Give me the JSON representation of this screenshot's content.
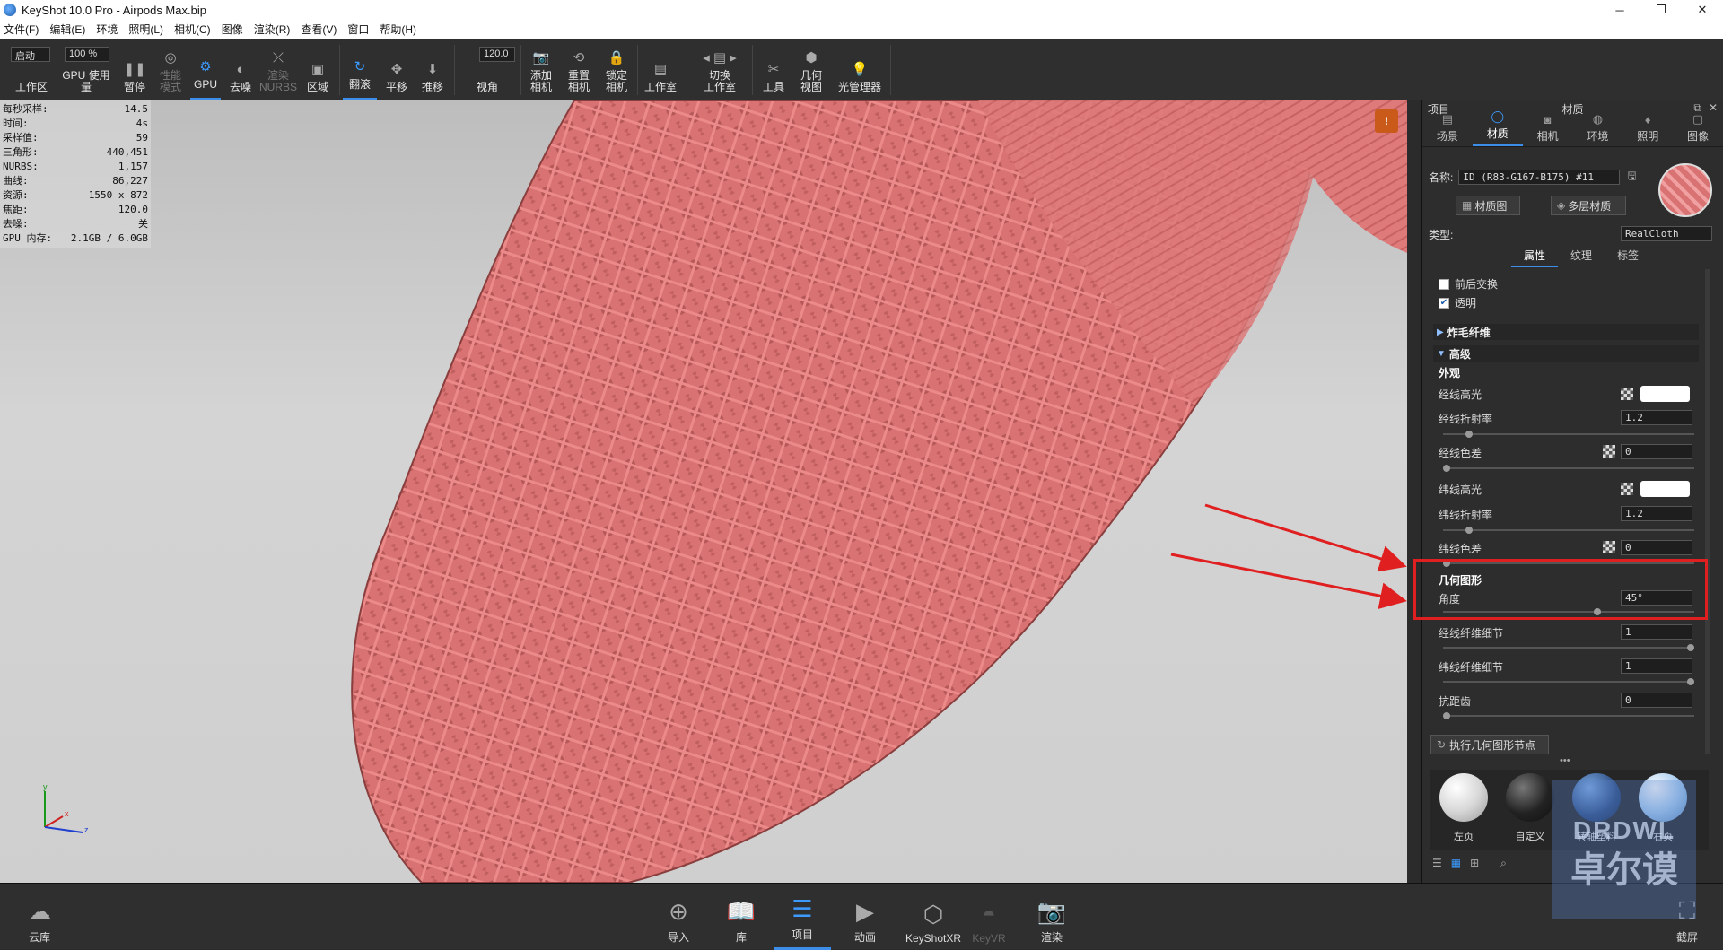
{
  "titlebar": {
    "title": "KeyShot 10.0 Pro  - Airpods Max.bip",
    "min": "─",
    "max": "❐",
    "close": "✕"
  },
  "menu": [
    "文件(F)",
    "编辑(E)",
    "环境",
    "照明(L)",
    "相机(C)",
    "图像",
    "渲染(R)",
    "查看(V)",
    "窗口",
    "帮助(H)"
  ],
  "toolbar": {
    "mode_select": "启动",
    "zoom_select": "100 %",
    "fov_value": "120.0",
    "workspace": "工作区",
    "gpu_usage": "GPU 使用量",
    "pause": "暂停",
    "perf_mode": "性能\n模式",
    "gpu": "GPU",
    "denoise": "去噪",
    "render_nurbs": "渲染\nNURBS",
    "region": "区域",
    "tumble": "翻滚",
    "pan": "平移",
    "dolly": "推移",
    "view_angle": "视角",
    "add_camera": "添加\n相机",
    "reset_camera": "重置\n相机",
    "lock_camera": "锁定\n相机",
    "studio": "工作室",
    "switch_studio": "切换\n工作室",
    "tools": "工具",
    "geo_view": "几何\n视图",
    "light_manager": "光管理器"
  },
  "stats": [
    {
      "k": "每秒采样:",
      "v": "14.5"
    },
    {
      "k": "时间:",
      "v": "4s"
    },
    {
      "k": "采样值:",
      "v": "59"
    },
    {
      "k": "三角形:",
      "v": "440,451"
    },
    {
      "k": "NURBS:",
      "v": "1,157"
    },
    {
      "k": "曲线:",
      "v": "86,227"
    },
    {
      "k": "资源:",
      "v": "1550 x 872"
    },
    {
      "k": "焦距:",
      "v": "120.0"
    },
    {
      "k": "去噪:",
      "v": "关"
    },
    {
      "k": "GPU 内存:",
      "v": "2.1GB / 6.0GB"
    }
  ],
  "axis": {
    "y": "y",
    "x": "x",
    "z": "z"
  },
  "panel": {
    "left_title": "项目",
    "title": "材质",
    "tabs": [
      "场景",
      "材质",
      "相机",
      "环境",
      "照明",
      "图像"
    ],
    "name_label": "名称:",
    "name_value": "ID (R83-G167-B175) #11",
    "material_graph_btn": "材质图",
    "multi_material_btn": "多层材质",
    "type_label": "类型:",
    "type_value": "RealCloth",
    "subtabs": [
      "属性",
      "纹理",
      "标签"
    ],
    "swap_label": "前后交换",
    "transparent_label": "透明",
    "fuzz_section": "炸毛纤维",
    "advanced_section": "高级",
    "appearance": "外观",
    "warp_spec": "经线高光",
    "warp_ior": "经线折射率",
    "warp_ior_val": "1.2",
    "warp_disp": "经线色差",
    "warp_disp_val": "0",
    "weft_spec": "纬线高光",
    "weft_ior": "纬线折射率",
    "weft_ior_val": "1.2",
    "weft_disp": "纬线色差",
    "weft_disp_val": "0",
    "geometry": "几何图形",
    "angle": "角度",
    "angle_val": "45°",
    "warp_detail": "经线纤维细节",
    "warp_detail_val": "1",
    "weft_detail": "纬线纤维细节",
    "weft_detail_val": "1",
    "antialias": "抗距齿",
    "antialias_val": "0",
    "run_geo_btn": "执行几何图形节点",
    "more": "•••"
  },
  "thumbs": [
    "左页",
    "自定义",
    "转轴塑料",
    "右页"
  ],
  "bottom": [
    "云库",
    "导入",
    "库",
    "项目",
    "动画",
    "KeyShotXR",
    "KeyVR",
    "渲染",
    "截屏"
  ],
  "watermark": {
    "top": "DRDWL",
    "bottom": "卓尔谟"
  },
  "colors": {
    "accent": "#3d8ee8",
    "fabric": "#e07070",
    "highlight_box": "#e02020"
  }
}
